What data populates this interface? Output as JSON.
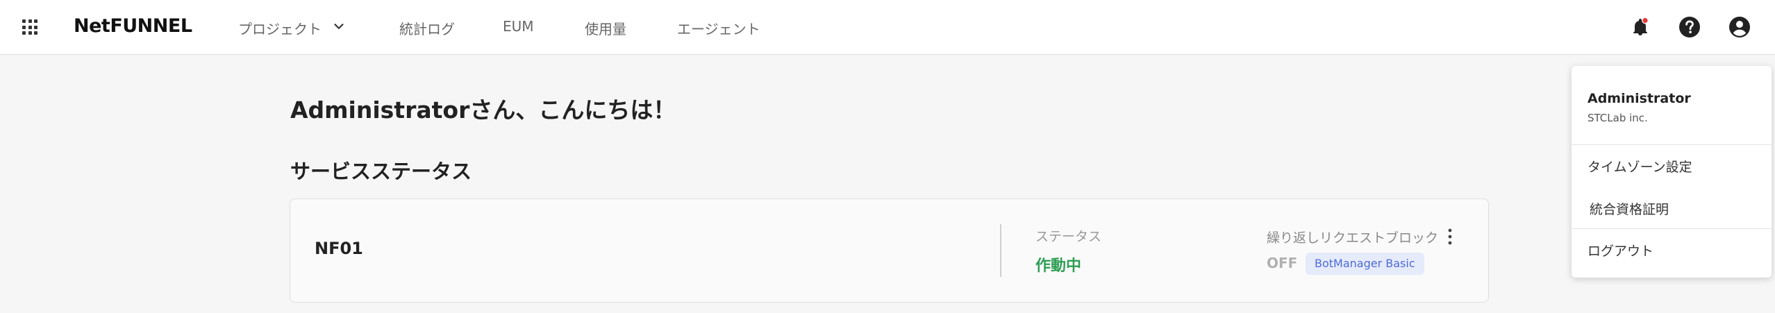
{
  "header": {
    "logo": "NetFUNNEL",
    "nav": {
      "project": "プロジェクト",
      "stats": "統計ログ",
      "eum": "EUM",
      "usage": "使用量",
      "agent": "エージェント"
    },
    "colors": {
      "notification_dot": "#e53935"
    }
  },
  "main": {
    "greeting": "Administratorさん、こんにちは！",
    "section_title": "サービスステータス",
    "service": {
      "name": "NF01",
      "status_label": "ステータス",
      "status_value": "作動中",
      "block_label": "繰り返しリクエストブロック",
      "block_value": "OFF",
      "badge": "BotManager Basic",
      "colors": {
        "status": "#2e9e54",
        "badge_bg": "#e6ebfb",
        "badge_text": "#4e6bd8"
      }
    }
  },
  "account_menu": {
    "username": "Administrator",
    "company": "STCLab inc.",
    "items": {
      "timezone": "タイムゾーン設定",
      "sso": "統合資格証明",
      "logout": "ログアウト"
    }
  }
}
